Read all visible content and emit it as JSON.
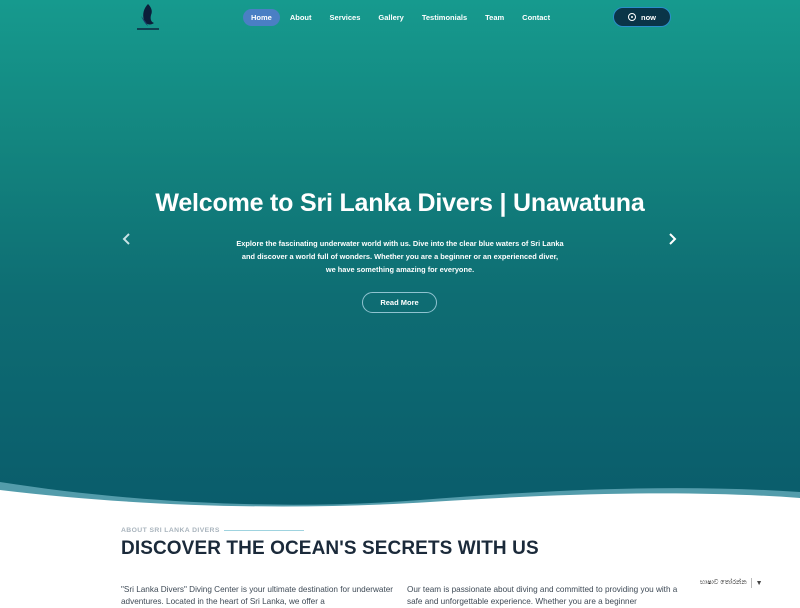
{
  "nav": {
    "items": [
      {
        "label": "Home",
        "active": true
      },
      {
        "label": "About",
        "active": false
      },
      {
        "label": "Services",
        "active": false
      },
      {
        "label": "Gallery",
        "active": false
      },
      {
        "label": "Testimonials",
        "active": false
      },
      {
        "label": "Team",
        "active": false
      },
      {
        "label": "Contact",
        "active": false
      }
    ],
    "whatsapp_label": "now"
  },
  "hero": {
    "title": "Welcome to Sri Lanka Divers | Unawatuna",
    "text": "Explore the fascinating underwater world with us. Dive into the clear blue waters of Sri Lanka and discover a world full of wonders. Whether you are a beginner or an experienced diver, we have something amazing for everyone.",
    "button": "Read More",
    "prev_icon": "chevron-left-icon",
    "next_icon": "chevron-right-icon"
  },
  "about": {
    "label": "ABOUT SRI LANKA DIVERS",
    "heading": "DISCOVER THE OCEAN'S SECRETS WITH US",
    "col1": "\"Sri Lanka Divers\" Diving Center is your ultimate destination for underwater adventures. Located in the heart of Sri Lanka, we offer a",
    "col2": "Our team is passionate about diving and committed to providing you with a safe and unforgettable experience. Whether you are a beginner"
  },
  "translate": {
    "label": "භාෂාව තෝරන්න"
  },
  "colors": {
    "hero_top": "#169a8e",
    "hero_bottom": "#0a5c6b",
    "active_nav": "#4a7fc4",
    "heading": "#1b2a3a"
  }
}
